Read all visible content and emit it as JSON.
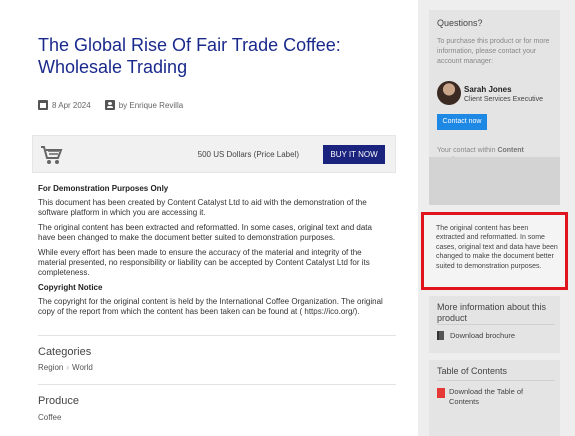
{
  "article": {
    "title": "The Global Rise Of Fair Trade Coffee: Wholesale Trading",
    "date": "8 Apr 2024",
    "author": "by Enrique Revilla",
    "price_label": "500 US Dollars (Price Label)",
    "buy_label": "BUY IT NOW",
    "demo_heading": "For Demonstration Purposes Only",
    "para1": "This document has been created by Content Catalyst Ltd to aid with the demonstration of the software platform in which you are accessing it.",
    "para2": "The original content has been extracted and reformatted. In some cases, original text and data have been changed to make the document better suited to demonstration purposes.",
    "para3": "While every effort has been made to ensure the accuracy of the material and integrity of the material presented, no responsibility or liability can be accepted by Content Catalyst Ltd for its completeness.",
    "copyright_heading": "Copyright Notice",
    "para4": "The copyright for the original content is held by the International Coffee Organization. The original copy of the report from which the content has been taken can be found at ( https://ico.org/).",
    "categories_title": "Categories",
    "categories": [
      "Region",
      "World"
    ],
    "produce_title": "Produce",
    "produce_value": "Coffee"
  },
  "sidebar": {
    "questions_title": "Questions?",
    "questions_text": "To purchase this product or for more information, please contact your account manager:",
    "person_name": "Sarah Jones",
    "person_role": "Client Services Executive",
    "contact_label": "Contact now",
    "within_prefix": "Your contact within",
    "within_bold": "Content Catalyst",
    "within_suffix": ":",
    "notice_text": "The original content has been extracted and reformatted. In some cases, original text and data have been changed to make the document better suited to demonstration purposes.",
    "more_title": "More information about this product",
    "brochure_label": "Download brochure",
    "toc_title": "Table of Contents",
    "toc_link": "Download the Table of Contents"
  },
  "colors": {
    "title": "#1a2a8c",
    "buy_button": "#1a237e",
    "contact_button": "#1e88e5",
    "highlight_border": "#e0141e"
  },
  "icons": [
    "calendar-icon",
    "user-icon",
    "cart-icon",
    "book-icon",
    "pdf-icon"
  ]
}
